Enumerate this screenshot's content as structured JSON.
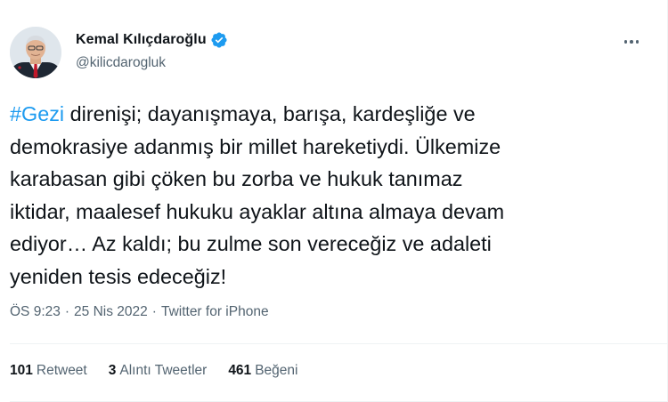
{
  "author": {
    "display_name": "Kemal Kılıçdaroğlu",
    "handle": "@kilicdarogluk",
    "verified": true
  },
  "tweet": {
    "hashtag": "#Gezi",
    "text": " direnişi; dayanışmaya, barışa, kardeşliğe ve\ndemokrasiye adanmış bir millet hareketiydi. Ülkemize\nkarabasan gibi çöken bu zorba ve hukuk tanımaz\niktidar, maalesef hukuku ayaklar altına almaya devam\nediyor… Az kaldı; bu zulme son vereceğiz ve adaleti\nyeniden tesis edeceğiz!"
  },
  "meta": {
    "time": "ÖS 9:23",
    "separator": "·",
    "date": "25 Nis 2022",
    "source": "Twitter for iPhone"
  },
  "stats": [
    {
      "count": "101",
      "label": "Retweet"
    },
    {
      "count": "3",
      "label": "Alıntı Tweetler"
    },
    {
      "count": "461",
      "label": "Beğeni"
    }
  ],
  "colors": {
    "hashtag": "#1d9bf0",
    "verified_badge": "#1d9bf0",
    "secondary_text": "#536471"
  },
  "icons": {
    "verified": "verified-badge-icon",
    "more": "more-options-icon"
  }
}
